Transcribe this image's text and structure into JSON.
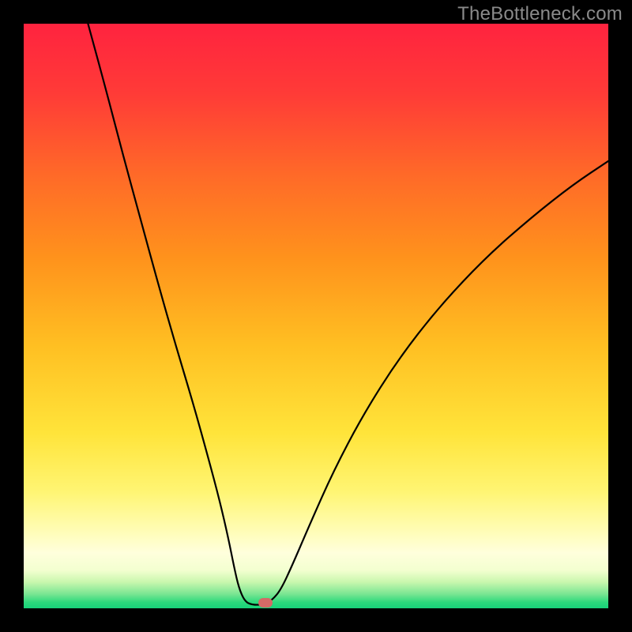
{
  "watermark": "TheBottleneck.com",
  "chart_data": {
    "type": "line",
    "title": "",
    "xlabel": "",
    "ylabel": "",
    "xlim": [
      0,
      100
    ],
    "ylim": [
      0,
      100
    ],
    "grid": false,
    "legend": false,
    "gradient_stops": [
      {
        "offset": 0.0,
        "color": "#ff233f"
      },
      {
        "offset": 0.12,
        "color": "#ff3b37"
      },
      {
        "offset": 0.26,
        "color": "#ff6a28"
      },
      {
        "offset": 0.4,
        "color": "#ff921c"
      },
      {
        "offset": 0.55,
        "color": "#ffbf22"
      },
      {
        "offset": 0.7,
        "color": "#ffe43a"
      },
      {
        "offset": 0.8,
        "color": "#fff573"
      },
      {
        "offset": 0.86,
        "color": "#fffcae"
      },
      {
        "offset": 0.905,
        "color": "#ffffdc"
      },
      {
        "offset": 0.935,
        "color": "#f3ffd0"
      },
      {
        "offset": 0.955,
        "color": "#c9f7ae"
      },
      {
        "offset": 0.975,
        "color": "#7ce693"
      },
      {
        "offset": 0.99,
        "color": "#2bd97c"
      },
      {
        "offset": 1.0,
        "color": "#18d27a"
      }
    ],
    "series": [
      {
        "name": "bottleneck-curve",
        "stroke": "#000000",
        "stroke_width": 2.2,
        "points": [
          {
            "x": 11.0,
            "y": 100.0
          },
          {
            "x": 14.0,
            "y": 89.0
          },
          {
            "x": 17.0,
            "y": 77.5
          },
          {
            "x": 20.0,
            "y": 66.5
          },
          {
            "x": 23.0,
            "y": 55.5
          },
          {
            "x": 26.0,
            "y": 45.0
          },
          {
            "x": 29.0,
            "y": 35.0
          },
          {
            "x": 31.5,
            "y": 26.0
          },
          {
            "x": 33.5,
            "y": 18.5
          },
          {
            "x": 35.0,
            "y": 12.0
          },
          {
            "x": 36.0,
            "y": 7.0
          },
          {
            "x": 36.8,
            "y": 3.5
          },
          {
            "x": 37.8,
            "y": 1.2
          },
          {
            "x": 39.0,
            "y": 0.6
          },
          {
            "x": 41.0,
            "y": 0.6
          },
          {
            "x": 42.5,
            "y": 1.4
          },
          {
            "x": 44.0,
            "y": 3.2
          },
          {
            "x": 46.0,
            "y": 7.5
          },
          {
            "x": 49.0,
            "y": 14.5
          },
          {
            "x": 53.0,
            "y": 23.5
          },
          {
            "x": 58.0,
            "y": 33.0
          },
          {
            "x": 64.0,
            "y": 42.5
          },
          {
            "x": 71.0,
            "y": 51.5
          },
          {
            "x": 79.0,
            "y": 60.0
          },
          {
            "x": 87.0,
            "y": 67.0
          },
          {
            "x": 94.0,
            "y": 72.5
          },
          {
            "x": 100.0,
            "y": 76.5
          }
        ]
      }
    ],
    "marker": {
      "x": 41.3,
      "y": 0.9,
      "color": "#d46a66"
    }
  }
}
